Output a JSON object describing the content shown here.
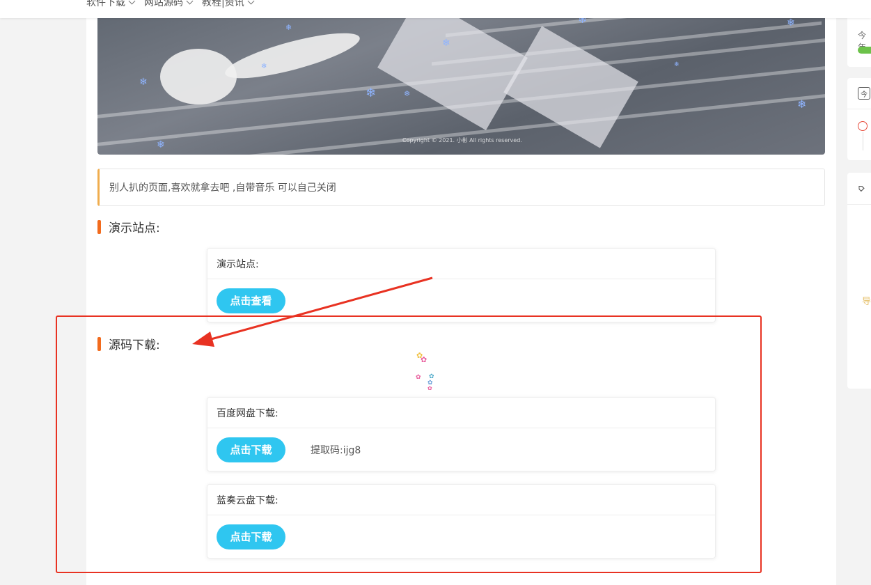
{
  "nav": {
    "items": [
      "软件下载",
      "网站源码",
      "教程|资讯"
    ]
  },
  "hero": {
    "copyright": "Copyright © 2021. 小彬 All rights reserved."
  },
  "notice": {
    "text": "别人扒的页面,喜欢就拿去吧 ,自带音乐 可以自己关闭"
  },
  "demo": {
    "section_title": "演示站点:",
    "box_title": "演示站点:",
    "button": "点击查看"
  },
  "download": {
    "section_title": "源码下载:",
    "baidu": {
      "title": "百度网盘下载:",
      "button": "点击下载",
      "code": "提取码:ijg8"
    },
    "lanzou": {
      "title": "蓝奏云盘下载:",
      "button": "点击下载"
    }
  },
  "sidebar": {
    "today_label": "今年",
    "calendar_icon_text": "今",
    "side_char": "导"
  },
  "colors": {
    "accent": "#2fc6f0",
    "section_bar": "#f26b1d",
    "annotation": "#e83222",
    "notice_border": "#f0ad4e"
  }
}
